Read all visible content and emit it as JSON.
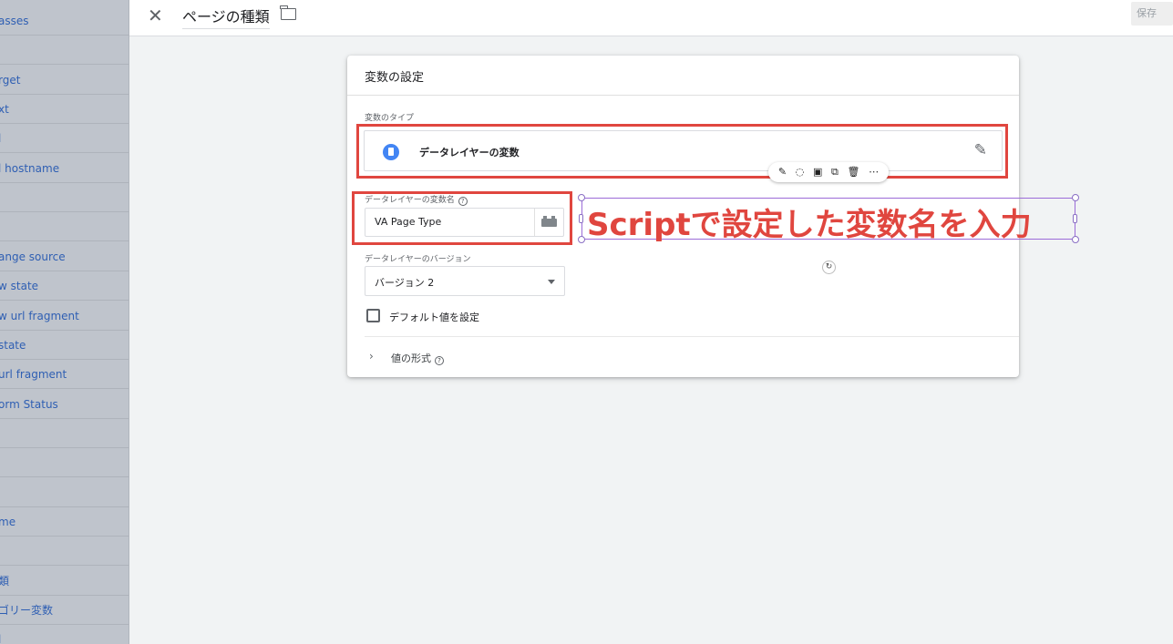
{
  "sidebar": {
    "items": [
      {
        "label": "asses"
      },
      {
        "label": ""
      },
      {
        "label": "rget"
      },
      {
        "label": "xt"
      },
      {
        "label": "l"
      },
      {
        "label": "l hostname"
      },
      {
        "label": ""
      },
      {
        "label": ""
      },
      {
        "label": "ange source"
      },
      {
        "label": "w state"
      },
      {
        "label": "w url fragment"
      },
      {
        "label": " state"
      },
      {
        "label": " url fragment"
      },
      {
        "label": "orm Status"
      },
      {
        "label": ""
      },
      {
        "label": ""
      },
      {
        "label": ""
      },
      {
        "label": "me"
      },
      {
        "label": ""
      },
      {
        "label": "類"
      },
      {
        "label": "ゴリー変数"
      },
      {
        "label": "l"
      }
    ]
  },
  "topbar": {
    "close_icon": "close-icon",
    "title": "ページの種類",
    "folder_icon": "folder-icon",
    "save_label": "保存"
  },
  "card": {
    "title": "変数の設定",
    "type_label": "変数のタイプ",
    "type_name": "データレイヤーの変数",
    "var_name_label": "データレイヤーの変数名",
    "var_name_value": "VA Page Type",
    "version_label": "データレイヤーのバージョン",
    "version_value": "バージョン 2",
    "default_checkbox_label": "デフォルト値を設定",
    "default_checked": false,
    "format_label": "値の形式"
  },
  "annotation": {
    "text": "Scriptで設定した変数名を入力",
    "color": "#e0463f",
    "selection_color": "#9b6bd8"
  },
  "float_toolbar": {
    "icons": [
      "magic-wand-icon",
      "lasso-icon",
      "lock-icon",
      "duplicate-icon",
      "trash-icon",
      "more-icon"
    ]
  },
  "colors": {
    "accent": "#4285f4",
    "highlight": "#e0463f"
  }
}
